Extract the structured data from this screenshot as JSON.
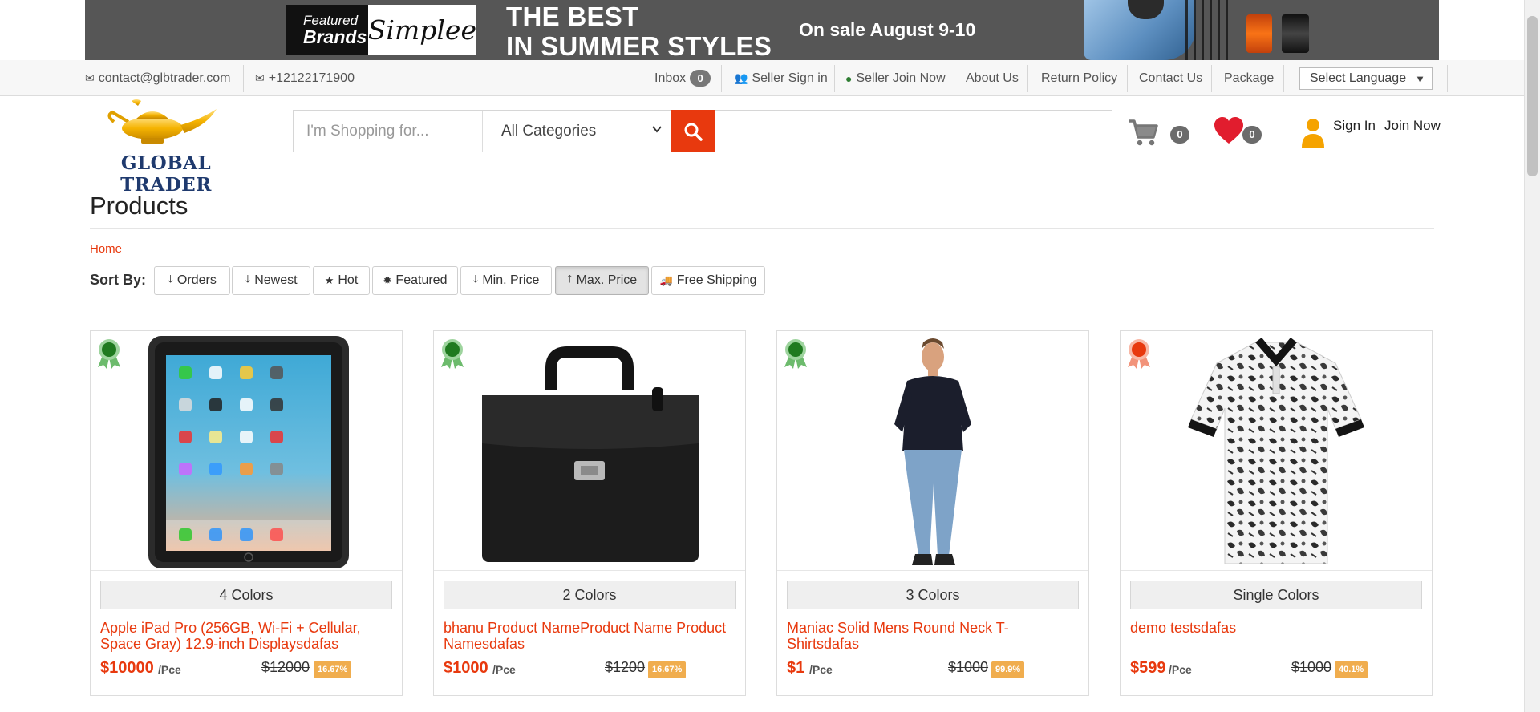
{
  "banner": {
    "featured_line1": "Featured",
    "featured_line2": "Brands",
    "brand": "Simplee",
    "headline_line1": "THE BEST",
    "headline_line2": "IN SUMMER STYLES",
    "sale": "On sale August 9-10"
  },
  "topbar": {
    "email": "contact@glbtrader.com",
    "phone": "+12122171900",
    "inbox_label": "Inbox",
    "inbox_count": "0",
    "seller_signin": "Seller Sign in",
    "seller_join": "Seller Join Now",
    "about": "About Us",
    "return_policy": "Return Policy",
    "contact": "Contact Us",
    "package": "Package",
    "language": "Select Language",
    "language_arrow": "▼"
  },
  "header": {
    "logo_text": "GLOBAL TRADER",
    "search_placeholder": "I'm Shopping for...",
    "category": "All Categories",
    "cart_count": "0",
    "wishlist_count": "0",
    "sign_in": "Sign In",
    "join_now": "Join Now"
  },
  "page": {
    "title": "Products",
    "breadcrumb": "Home",
    "sort_label": "Sort By:"
  },
  "sort_buttons": [
    {
      "label": "Orders",
      "icon": "arrow-down-icon",
      "glyph": "🡓"
    },
    {
      "label": "Newest",
      "icon": "arrow-down-icon",
      "glyph": "🡓"
    },
    {
      "label": "Hot",
      "icon": "star-icon",
      "glyph": "★"
    },
    {
      "label": "Featured",
      "icon": "certificate-icon",
      "glyph": "✹"
    },
    {
      "label": "Min. Price",
      "icon": "arrow-down-icon",
      "glyph": "🡓"
    },
    {
      "label": "Max. Price",
      "icon": "arrow-up-icon",
      "glyph": "🡑"
    },
    {
      "label": "Free Shipping",
      "icon": "truck-icon",
      "glyph": "🚚"
    }
  ],
  "products": [
    {
      "colors": "4 Colors",
      "name": "Apple iPad Pro (256GB, Wi-Fi + Cellular, Space Gray) 12.9-inch Displaysdafas",
      "price": "$10000",
      "unit": "/Pce",
      "old_price": "$12000",
      "discount": "16.67%",
      "award_color": "#1f7a1f",
      "image": "tablet-image"
    },
    {
      "colors": "2 Colors",
      "name": "bhanu Product NameProduct Name Product Namesdafas",
      "price": "$1000",
      "unit": "/Pce",
      "old_price": "$1200",
      "discount": "16.67%",
      "award_color": "#1f7a1f",
      "image": "briefcase-image"
    },
    {
      "colors": "3 Colors",
      "name": "Maniac Solid Mens Round Neck T-Shirtsdafas",
      "price": "$1",
      "unit": "/Pce",
      "old_price": "$1000",
      "discount": "99.9%",
      "award_color": "#1f7a1f",
      "image": "man-in-tshirt-image"
    },
    {
      "colors": "Single Colors",
      "name": "demo testsdafas",
      "price": "$599",
      "unit": "/Pce",
      "old_price": "$1000",
      "discount": "40.1%",
      "award_color": "#e8390e",
      "image": "polo-shirt-image"
    }
  ],
  "colors": {
    "accent": "#e8390e",
    "discount": "#f0ad4e",
    "award_green": "#1f7a1f",
    "award_orange": "#e8390e"
  }
}
